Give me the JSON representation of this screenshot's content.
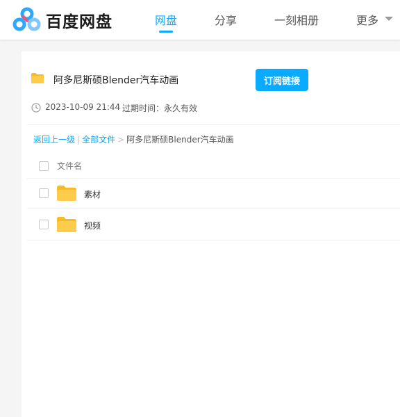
{
  "header": {
    "brand": "百度网盘",
    "nav": [
      {
        "label": "网盘"
      },
      {
        "label": "分享"
      },
      {
        "label": "一刻相册"
      },
      {
        "label": "更多"
      }
    ],
    "active_nav": "网盘",
    "accent": "#09aaff"
  },
  "share": {
    "title": "阿多尼斯硕Blender汽车动画",
    "subscribe_label": "订阅链接",
    "date": "2023-10-09 21:44",
    "expire_label": "过期时间：",
    "expire_value": "永久有效"
  },
  "breadcrumb": {
    "back": "返回上一级",
    "sep1": "|",
    "all": "全部文件",
    "sep2": ">",
    "current": "阿多尼斯硕Blender汽车动画"
  },
  "file_list": {
    "column_header": "文件名",
    "rows": [
      {
        "name": "素材",
        "icon": "folder-icon"
      },
      {
        "name": "视频",
        "icon": "folder-icon"
      }
    ]
  }
}
